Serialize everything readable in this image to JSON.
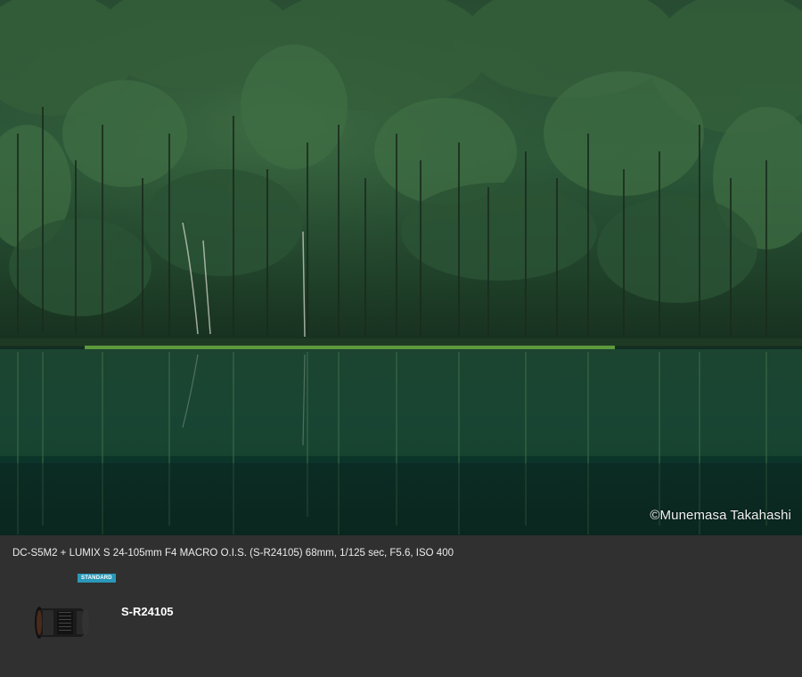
{
  "photo": {
    "description_icon": "lake-forest-photo",
    "credit": "©Munemasa Takahashi"
  },
  "info": {
    "caption": "DC-S5M2 + LUMIX S 24-105mm F4 MACRO O.I.S. (S-R24105) 68mm, 1/125 sec, F5.6, ISO 400",
    "badge": "STANDARD",
    "lens_name": "S-R24105",
    "lens_icon": "lens-icon"
  },
  "colors": {
    "panel_bg": "#303031",
    "badge_bg": "#2a98b8",
    "text": "#ececec"
  }
}
